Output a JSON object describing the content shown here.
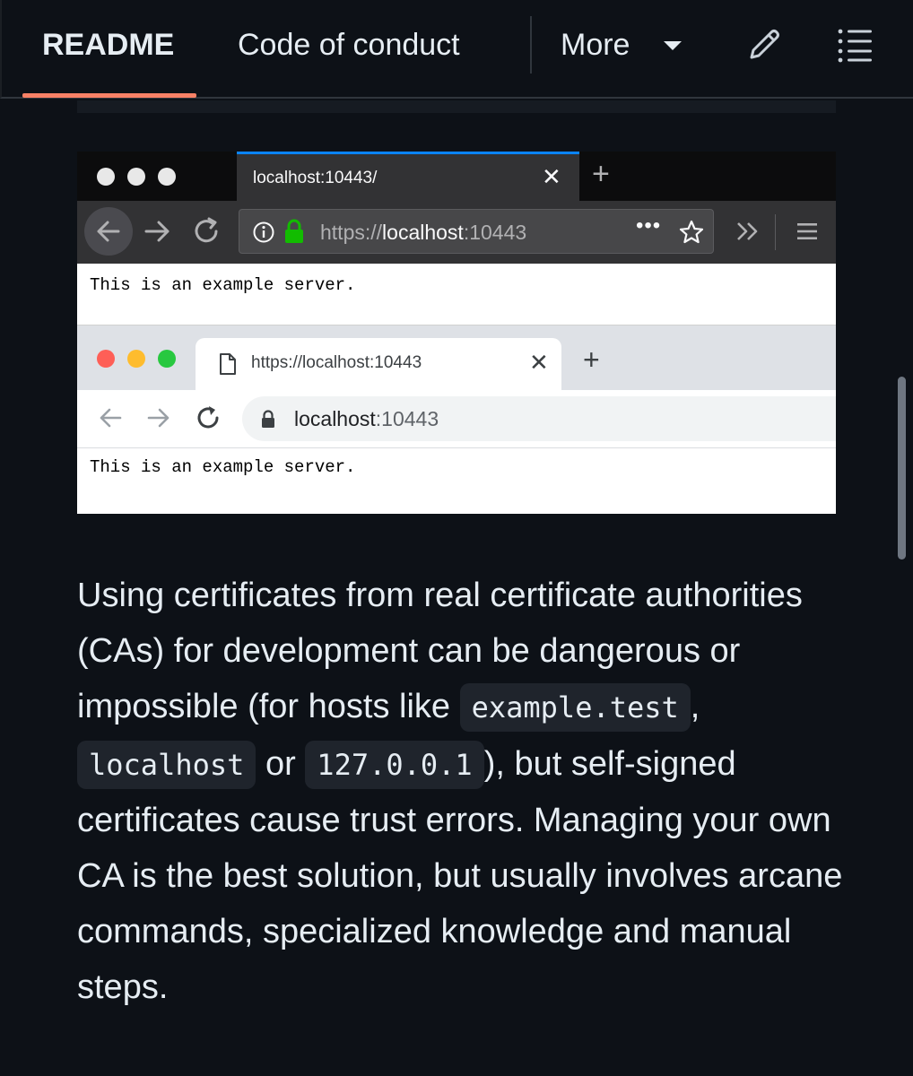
{
  "tabs": {
    "readme": "README",
    "code_of_conduct": "Code of conduct",
    "more": "More"
  },
  "icons": {
    "edit": "pencil-icon",
    "toc": "list-icon",
    "more_caret": "caret-down-icon"
  },
  "colors": {
    "background": "#0d1117",
    "active_tab_underline": "#f78166",
    "firefox_accent": "#0a84ff",
    "lock_green": "#12bc00"
  },
  "firefox": {
    "tab_title": "localhost:10443/",
    "url_scheme": "https://",
    "url_host": "localhost",
    "url_port": ":10443",
    "page_text": "This is an example server."
  },
  "chrome": {
    "tab_title": "https://localhost:10443",
    "url_host": "localhost",
    "url_port": ":10443",
    "page_text": "This is an example server."
  },
  "prose": {
    "p1": "Using certificates from real certificate authorities (CAs) for development can be dangerous or impossible (for hosts like ",
    "code1": "example.test",
    "sep1": ", ",
    "code2": "localhost",
    "sep2": " or ",
    "code3": "127.0.0.1",
    "p2": "), but self-signed certificates cause trust errors. Managing your own CA is the best solution, but usually involves arcane commands, specialized knowledge and manual steps."
  }
}
